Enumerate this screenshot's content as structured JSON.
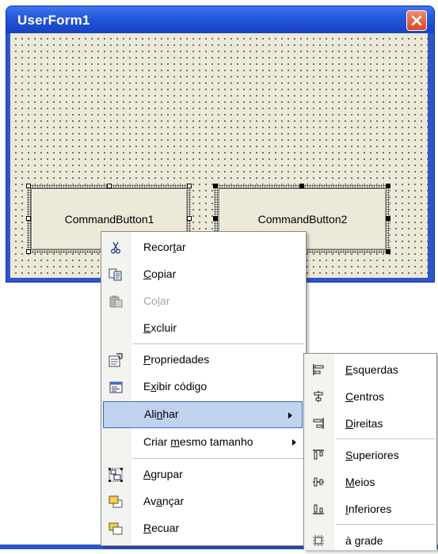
{
  "window": {
    "title": "UserForm1"
  },
  "controls": {
    "button1": "CommandButton1",
    "button2": "CommandButton2"
  },
  "context_menu": {
    "items": [
      {
        "pre": "Recor",
        "acc": "t",
        "post": "ar",
        "icon": "cut-icon"
      },
      {
        "pre": "",
        "acc": "C",
        "post": "opiar",
        "icon": "copy-icon"
      },
      {
        "pre": "Co",
        "acc": "l",
        "post": "ar",
        "icon": "paste-icon",
        "disabled": true
      },
      {
        "pre": "",
        "acc": "E",
        "post": "xcluir",
        "icon": ""
      },
      {
        "pre": "",
        "acc": "P",
        "post": "ropriedades",
        "icon": "properties-icon"
      },
      {
        "pre": "E",
        "acc": "x",
        "post": "ibir código",
        "icon": "view-code-icon"
      },
      {
        "pre": "Ali",
        "acc": "n",
        "post": "har",
        "icon": "",
        "submenu": true,
        "highlighted": true
      },
      {
        "pre": "Criar ",
        "acc": "m",
        "post": "esmo tamanho",
        "icon": "",
        "submenu": true
      },
      {
        "pre": "",
        "acc": "A",
        "post": "grupar",
        "icon": "group-icon"
      },
      {
        "pre": "Av",
        "acc": "a",
        "post": "nçar",
        "icon": "bring-forward-icon"
      },
      {
        "pre": "",
        "acc": "R",
        "post": "ecuar",
        "icon": "send-backward-icon"
      }
    ]
  },
  "align_submenu": {
    "items": [
      {
        "pre": "",
        "acc": "E",
        "post": "squerdas",
        "icon": "align-lefts-icon"
      },
      {
        "pre": "",
        "acc": "C",
        "post": "entros",
        "icon": "align-centers-icon"
      },
      {
        "pre": "",
        "acc": "D",
        "post": "ireitas",
        "icon": "align-rights-icon"
      },
      {
        "pre": "",
        "acc": "S",
        "post": "uperiores",
        "icon": "align-tops-icon"
      },
      {
        "pre": "",
        "acc": "M",
        "post": "eios",
        "icon": "align-middles-icon"
      },
      {
        "pre": "",
        "acc": "I",
        "post": "nferiores",
        "icon": "align-bottoms-icon"
      },
      {
        "pre": "à ",
        "acc": "g",
        "post": "rade",
        "icon": "align-to-grid-icon"
      }
    ]
  }
}
